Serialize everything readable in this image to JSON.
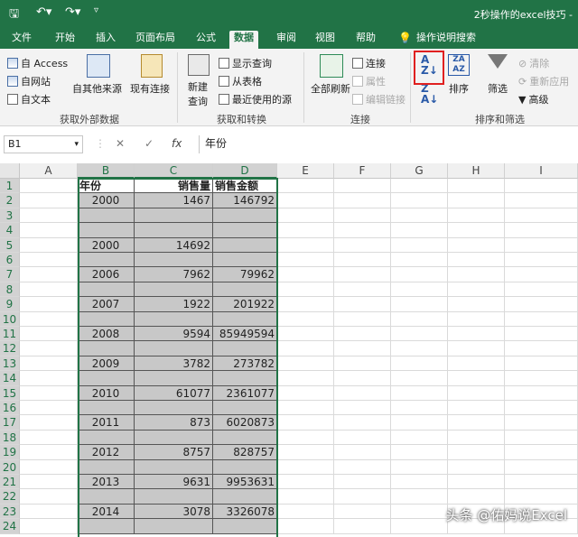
{
  "title_bar": {
    "doc_title": "2秒操作的excel技巧 -"
  },
  "tabs": [
    "文件",
    "开始",
    "插入",
    "页面布局",
    "公式",
    "数据",
    "审阅",
    "视图",
    "帮助",
    "操作说明搜索"
  ],
  "ribbon": {
    "get_external": {
      "access": "自 Access",
      "web": "自网站",
      "text": "自文本",
      "other": "自其他来源",
      "existing": "现有连接",
      "label": "获取外部数据"
    },
    "get_transform": {
      "new_query": "新建",
      "new_query2": "查询",
      "show_queries": "显示查询",
      "from_table": "从表格",
      "recent_sources": "最近使用的源",
      "label": "获取和转换"
    },
    "connections": {
      "refresh_all": "全部刷新",
      "connections": "连接",
      "properties": "属性",
      "edit_links": "编辑链接",
      "label": "连接"
    },
    "sort_filter": {
      "sort": "排序",
      "filter": "筛选",
      "clear": "清除",
      "reapply": "重新应用",
      "advanced": "高级",
      "label": "排序和筛选"
    }
  },
  "formula_bar": {
    "name_box": "B1",
    "cancel": "✕",
    "enter": "✓",
    "fx": "fx",
    "value": "年份"
  },
  "columns": [
    "A",
    "B",
    "C",
    "D",
    "E",
    "F",
    "G",
    "H",
    "I"
  ],
  "rows": [
    "1",
    "2",
    "3",
    "4",
    "5",
    "6",
    "7",
    "8",
    "9",
    "10",
    "11",
    "12",
    "13",
    "14",
    "15",
    "16",
    "17",
    "18",
    "19",
    "20",
    "21",
    "22",
    "23",
    "24"
  ],
  "header_row": [
    "年份",
    "销售量",
    "销售金额"
  ],
  "data": [
    {
      "row": 2,
      "year": "2000",
      "qty": "1467",
      "amount": "146792"
    },
    {
      "row": 5,
      "year": "2000",
      "qty": "14692",
      "amount": ""
    },
    {
      "row": 7,
      "year": "2006",
      "qty": "7962",
      "amount": "79962"
    },
    {
      "row": 9,
      "year": "2007",
      "qty": "1922",
      "amount": "201922"
    },
    {
      "row": 11,
      "year": "2008",
      "qty": "9594",
      "amount": "85949594"
    },
    {
      "row": 13,
      "year": "2009",
      "qty": "3782",
      "amount": "273782"
    },
    {
      "row": 15,
      "year": "2010",
      "qty": "61077",
      "amount": "2361077"
    },
    {
      "row": 17,
      "year": "2011",
      "qty": "873",
      "amount": "6020873"
    },
    {
      "row": 19,
      "year": "2012",
      "qty": "8757",
      "amount": "828757"
    },
    {
      "row": 21,
      "year": "2013",
      "qty": "9631",
      "amount": "9953631"
    },
    {
      "row": 23,
      "year": "2014",
      "qty": "3078",
      "amount": "3326078"
    }
  ],
  "watermark": "头条 @佑妈说Excel",
  "colors": {
    "excel_green": "#217346",
    "highlight_red": "#e02020",
    "cell_shade": "#c8c8c8"
  }
}
